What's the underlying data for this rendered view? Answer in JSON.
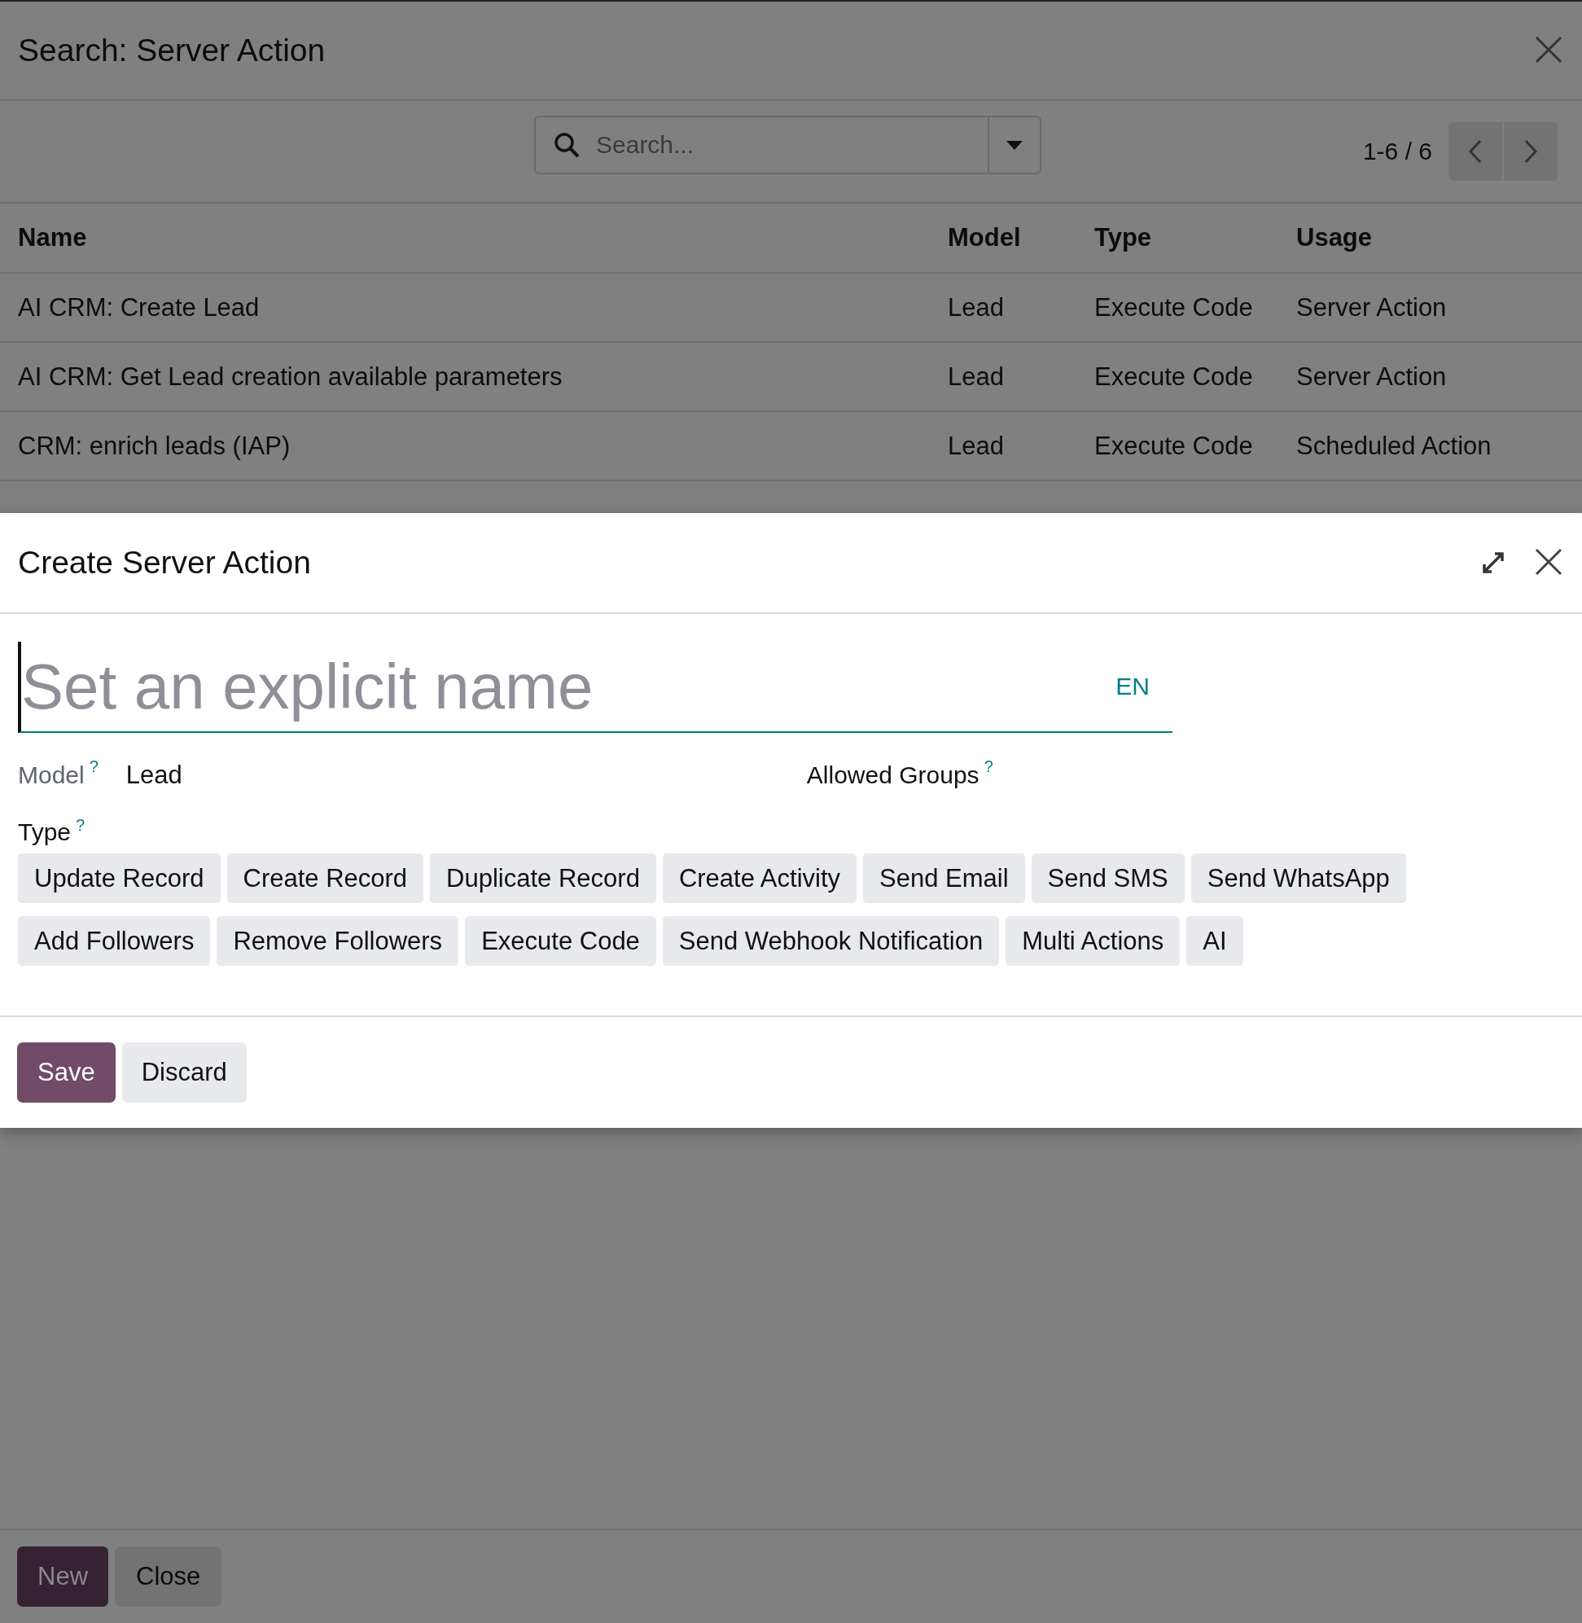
{
  "search_dialog": {
    "title": "Search: Server Action",
    "search": {
      "placeholder": "Search..."
    },
    "pager": "1-6 / 6",
    "table": {
      "columns": [
        "Name",
        "Model",
        "Type",
        "Usage"
      ],
      "rows": [
        [
          "AI CRM: Create Lead",
          "Lead",
          "Execute Code",
          "Server Action"
        ],
        [
          "AI CRM: Get Lead creation available parameters",
          "Lead",
          "Execute Code",
          "Server Action"
        ],
        [
          "CRM: enrich leads (IAP)",
          "Lead",
          "Execute Code",
          "Scheduled Action"
        ]
      ]
    },
    "buttons": [
      {
        "label": "New",
        "kind": "primary"
      },
      {
        "label": "Close",
        "kind": "secondary"
      }
    ]
  },
  "create_dialog": {
    "title": "Create Server Action",
    "name_field": {
      "placeholder": "Set an explicit name",
      "language": "EN"
    },
    "model": {
      "label": "Model",
      "help": "?",
      "value": "Lead"
    },
    "allowed_groups": {
      "label": "Allowed Groups",
      "help": "?"
    },
    "type": {
      "label": "Type",
      "help": "?",
      "options": [
        "Update Record",
        "Create Record",
        "Duplicate Record",
        "Create Activity",
        "Send Email",
        "Send SMS",
        "Send WhatsApp",
        "Add Followers",
        "Remove Followers",
        "Execute Code",
        "Send Webhook Notification",
        "Multi Actions",
        "AI"
      ]
    },
    "buttons": [
      {
        "label": "Save",
        "kind": "primary"
      },
      {
        "label": "Discard",
        "kind": "secondary"
      }
    ]
  }
}
